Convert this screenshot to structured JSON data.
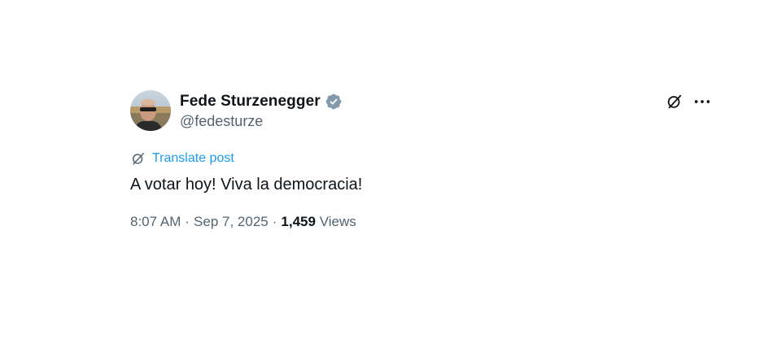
{
  "author": {
    "display_name": "Fede Sturzenegger",
    "handle": "@fedesturze",
    "verified": true,
    "avatar_icon": "profile-photo"
  },
  "actions": {
    "grok_icon": "grok-icon",
    "more_icon": "more-dots-icon"
  },
  "translate": {
    "icon": "translate-icon",
    "label": "Translate post"
  },
  "post": {
    "text": "A votar hoy! Viva la democracia!",
    "time": "8:07 AM",
    "separator": "·",
    "date": "Sep 7, 2025",
    "views_count": "1,459",
    "views_label": "Views"
  },
  "colors": {
    "accent": "#1d9bf0",
    "text_primary": "#0f1419",
    "text_secondary": "#536471",
    "verified_badge": "#829aab"
  }
}
